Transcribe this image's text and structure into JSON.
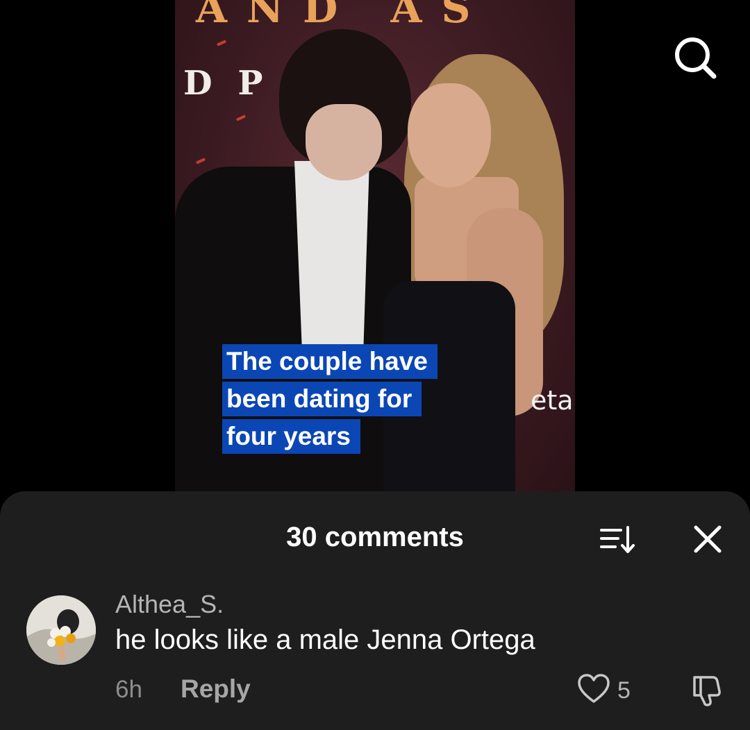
{
  "video": {
    "backdrop_top": "AND AS",
    "backdrop_mid": "D P    E",
    "caption_lines": [
      "The couple have",
      "been dating for",
      "four years"
    ],
    "watermark": "eta"
  },
  "comments_sheet": {
    "title": "30 comments",
    "comment": {
      "username": "Althea_S.",
      "text": "he looks like a male Jenna Ortega",
      "timestamp": "6h",
      "reply_label": "Reply",
      "like_count": "5"
    }
  },
  "colors": {
    "sheet_background": "#1e1e1f",
    "caption_background": "#0b46b5",
    "screen_background": "#000000"
  },
  "icons": {
    "search": "search-icon",
    "sort": "sort-icon",
    "close": "close-icon",
    "like": "heart-icon",
    "dislike": "thumbs-down-icon"
  }
}
